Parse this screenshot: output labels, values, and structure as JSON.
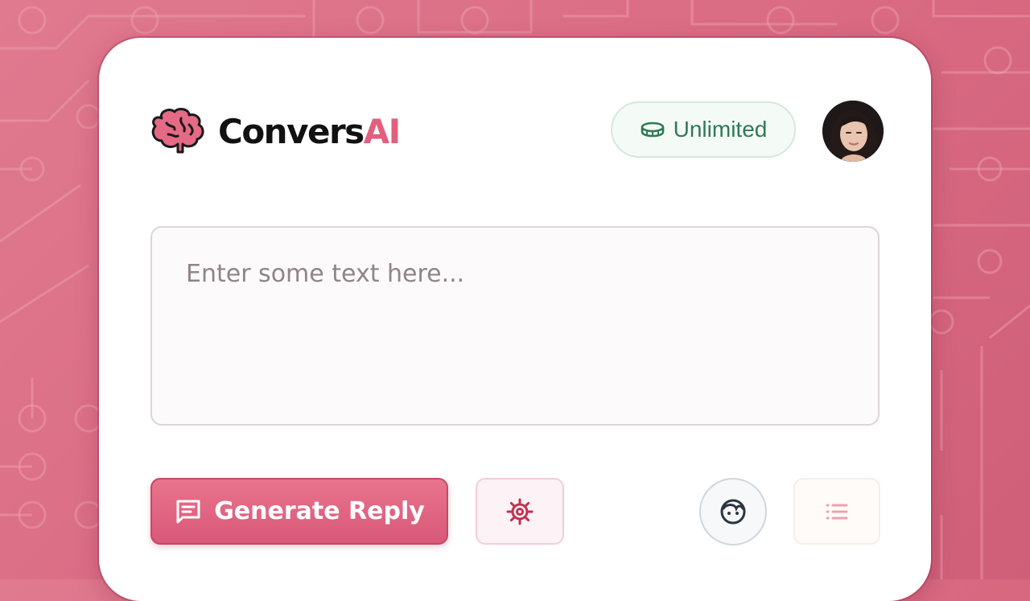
{
  "app": {
    "name_part1": "Convers",
    "name_part2": "AI",
    "logo_icon": "brain-icon"
  },
  "header": {
    "plan_badge": {
      "label": "Unlimited",
      "icon": "coin-icon"
    },
    "avatar": {
      "icon": "user-avatar"
    }
  },
  "editor": {
    "placeholder": "Enter some text here...",
    "value": ""
  },
  "actions": {
    "generate": {
      "label": "Generate Reply",
      "icon": "message-icon"
    },
    "settings": {
      "icon": "gear-icon"
    },
    "persona": {
      "icon": "face-icon"
    },
    "history": {
      "icon": "list-icon"
    }
  },
  "colors": {
    "background": "#d96a82",
    "accent": "#e0607e",
    "badge_text": "#2f7a55",
    "card": "#ffffff"
  }
}
